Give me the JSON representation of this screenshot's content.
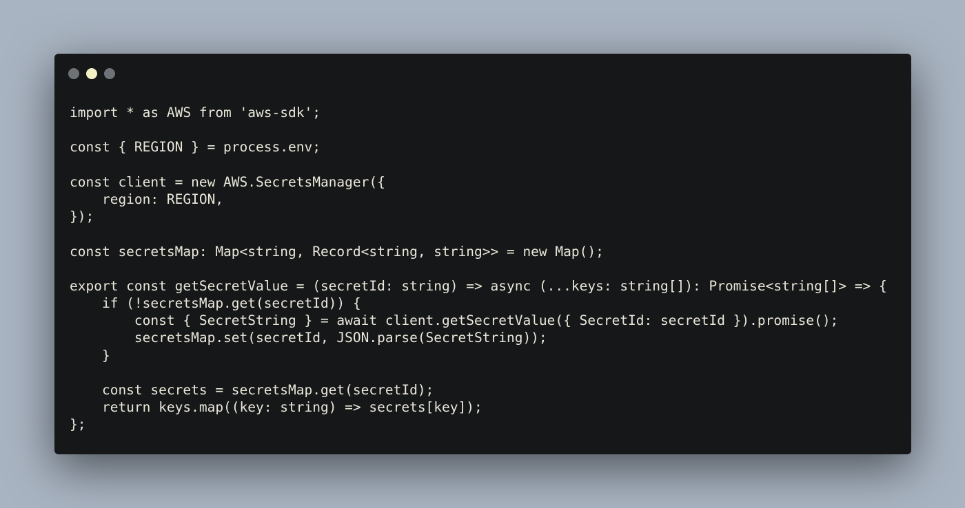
{
  "window": {
    "dots": [
      {
        "name": "dot-close",
        "color": "#6d7277"
      },
      {
        "name": "dot-minimize",
        "color": "#f4f0c6"
      },
      {
        "name": "dot-maximize",
        "color": "#6d7277"
      }
    ]
  },
  "colors": {
    "background": "#a9b4c2",
    "window": "#151718",
    "text": "#eae7db",
    "muted": "#c9ccd2"
  },
  "code": {
    "lines": [
      [
        {
          "t": "import * as AWS from 'aws-sdk';",
          "c": "plain"
        }
      ],
      [],
      [
        {
          "t": "const { REGION } = process.env;",
          "c": "plain"
        }
      ],
      [],
      [
        {
          "t": "const client = new AWS.SecretsManager({",
          "c": "plain"
        }
      ],
      [
        {
          "t": "    region: REGION,",
          "c": "plain"
        }
      ],
      [
        {
          "t": "});",
          "c": "plain"
        }
      ],
      [],
      [
        {
          "t": "const secretsMap: Map<string, Record<string, string>> = new Map();",
          "c": "plain"
        }
      ],
      [],
      [
        {
          "t": "export const getSecretValue = (secretId: string) => async (...keys: string[]): Promise<string[]> => {",
          "c": "plain"
        }
      ],
      [
        {
          "t": "    if (!secretsMap.get(secretId)) {",
          "c": "plain"
        }
      ],
      [
        {
          "t": "        const { SecretString } = await client.getSecretValue({ SecretId: secretId }).promise();",
          "c": "plain"
        }
      ],
      [
        {
          "t": "        secretsMap.set(secretId, JSON.parse(SecretString));",
          "c": "plain"
        }
      ],
      [
        {
          "t": "    }",
          "c": "plain"
        }
      ],
      [],
      [
        {
          "t": "    const secrets = secretsMap.get(secretId);",
          "c": "plain"
        }
      ],
      [
        {
          "t": "    return keys.map((key: string) => secrets[key]);",
          "c": "plain"
        }
      ],
      [
        {
          "t": "};",
          "c": "plain"
        }
      ]
    ]
  }
}
